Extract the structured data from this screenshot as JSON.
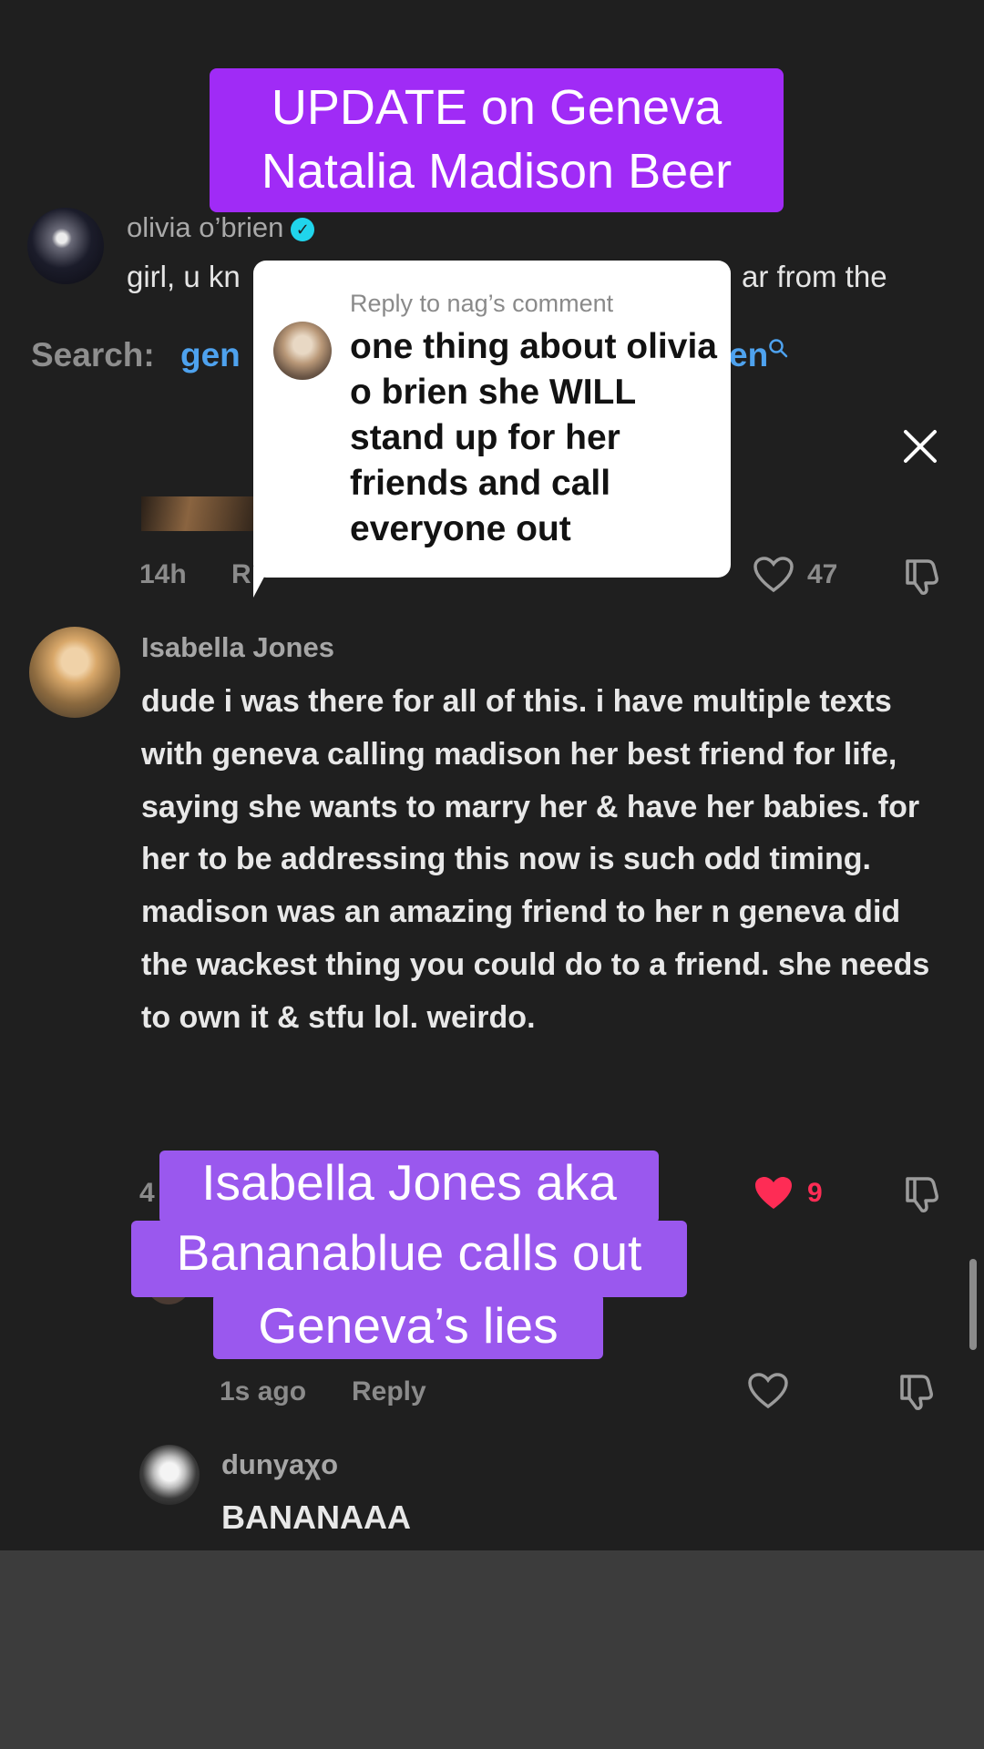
{
  "overlay_title": {
    "line1": "UPDATE on Geneva",
    "line2": "Natalia Madison Beer"
  },
  "top_comment": {
    "username": "olivia o’brien",
    "text_left": "girl, u kn",
    "text_right": "ar from the"
  },
  "search": {
    "label": "Search:",
    "term_left": "gen",
    "term_right": "en"
  },
  "reply_card": {
    "header": "Reply to nag’s comment",
    "body": "one thing about olivia o brien she WILL stand up for her friends and call everyone out"
  },
  "first_meta": {
    "time": "14h",
    "reply_partial": "R",
    "likes": "47"
  },
  "isabella_comment": {
    "username": "Isabella Jones",
    "text": "dude i was there for all of this. i have multiple texts with geneva calling madison her best friend for life, saying she wants to marry her & have her babies. for her to be addressing this now is such odd timing. madison was an amazing friend to her n geneva did the wackest thing you could do to a friend. she needs to own it & stfu lol. weirdo.",
    "time_partial": "4",
    "likes": "9"
  },
  "caption_overlay": {
    "line1": "Isabella Jones aka",
    "line2": "Bananablue calls out",
    "line3": "Geneva’s lies"
  },
  "reply_row": {
    "time": "1s ago",
    "reply_label": "Reply"
  },
  "dunya_comment": {
    "username": "dunyaχo",
    "text": "BANANAAA"
  },
  "colors": {
    "title_bg": "#a02bf6",
    "caption_bg": "#9a58ee",
    "like_red": "#fe2c55",
    "search_blue": "#4ea2ee",
    "verified": "#20d5ec"
  }
}
